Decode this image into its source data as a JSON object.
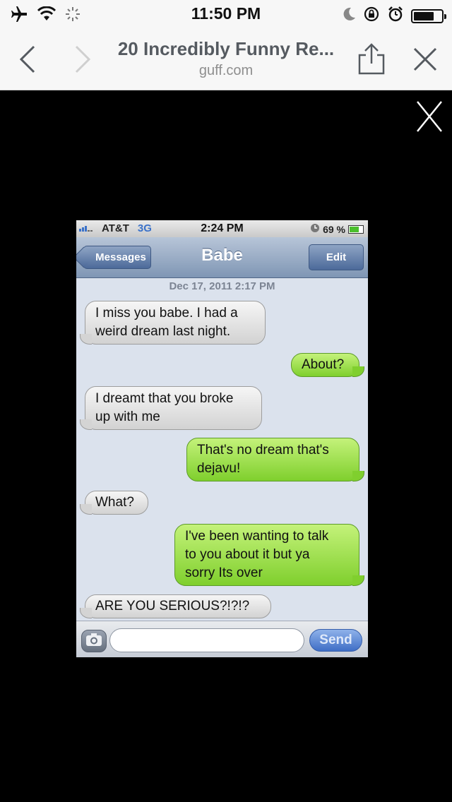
{
  "status_bar": {
    "time": "11:50 PM"
  },
  "browser": {
    "title": "20 Incredibly Funny Re...",
    "domain": "guff.com"
  },
  "screenshot": {
    "status": {
      "carrier": "AT&T",
      "network": "3G",
      "time": "2:24 PM",
      "battery": "69 %"
    },
    "toolbar": {
      "back_label": "Messages",
      "title": "Babe",
      "edit_label": "Edit"
    },
    "date": "Dec 17, 2011 2:17 PM",
    "messages": [
      {
        "side": "in",
        "line1": "I miss you babe. I had a",
        "line2": "weird dream last night."
      },
      {
        "side": "out",
        "line1": "About?"
      },
      {
        "side": "in",
        "line1": "I dreamt that you broke",
        "line2": "up with me"
      },
      {
        "side": "out",
        "line1": "That's no dream that's",
        "line2": "dejavu!"
      },
      {
        "side": "in",
        "line1": "What?"
      },
      {
        "side": "out",
        "line1": "I've been wanting to talk",
        "line2": "to you about it but ya",
        "line3": "sorry Its over"
      },
      {
        "side": "in",
        "line1": "ARE YOU SERIOUS?!?!?"
      }
    ],
    "compose": {
      "send_label": "Send"
    }
  },
  "colors": {
    "incoming": "#d8d8d8",
    "outgoing": "#8fd83c",
    "accent": "#4c6a9a"
  }
}
